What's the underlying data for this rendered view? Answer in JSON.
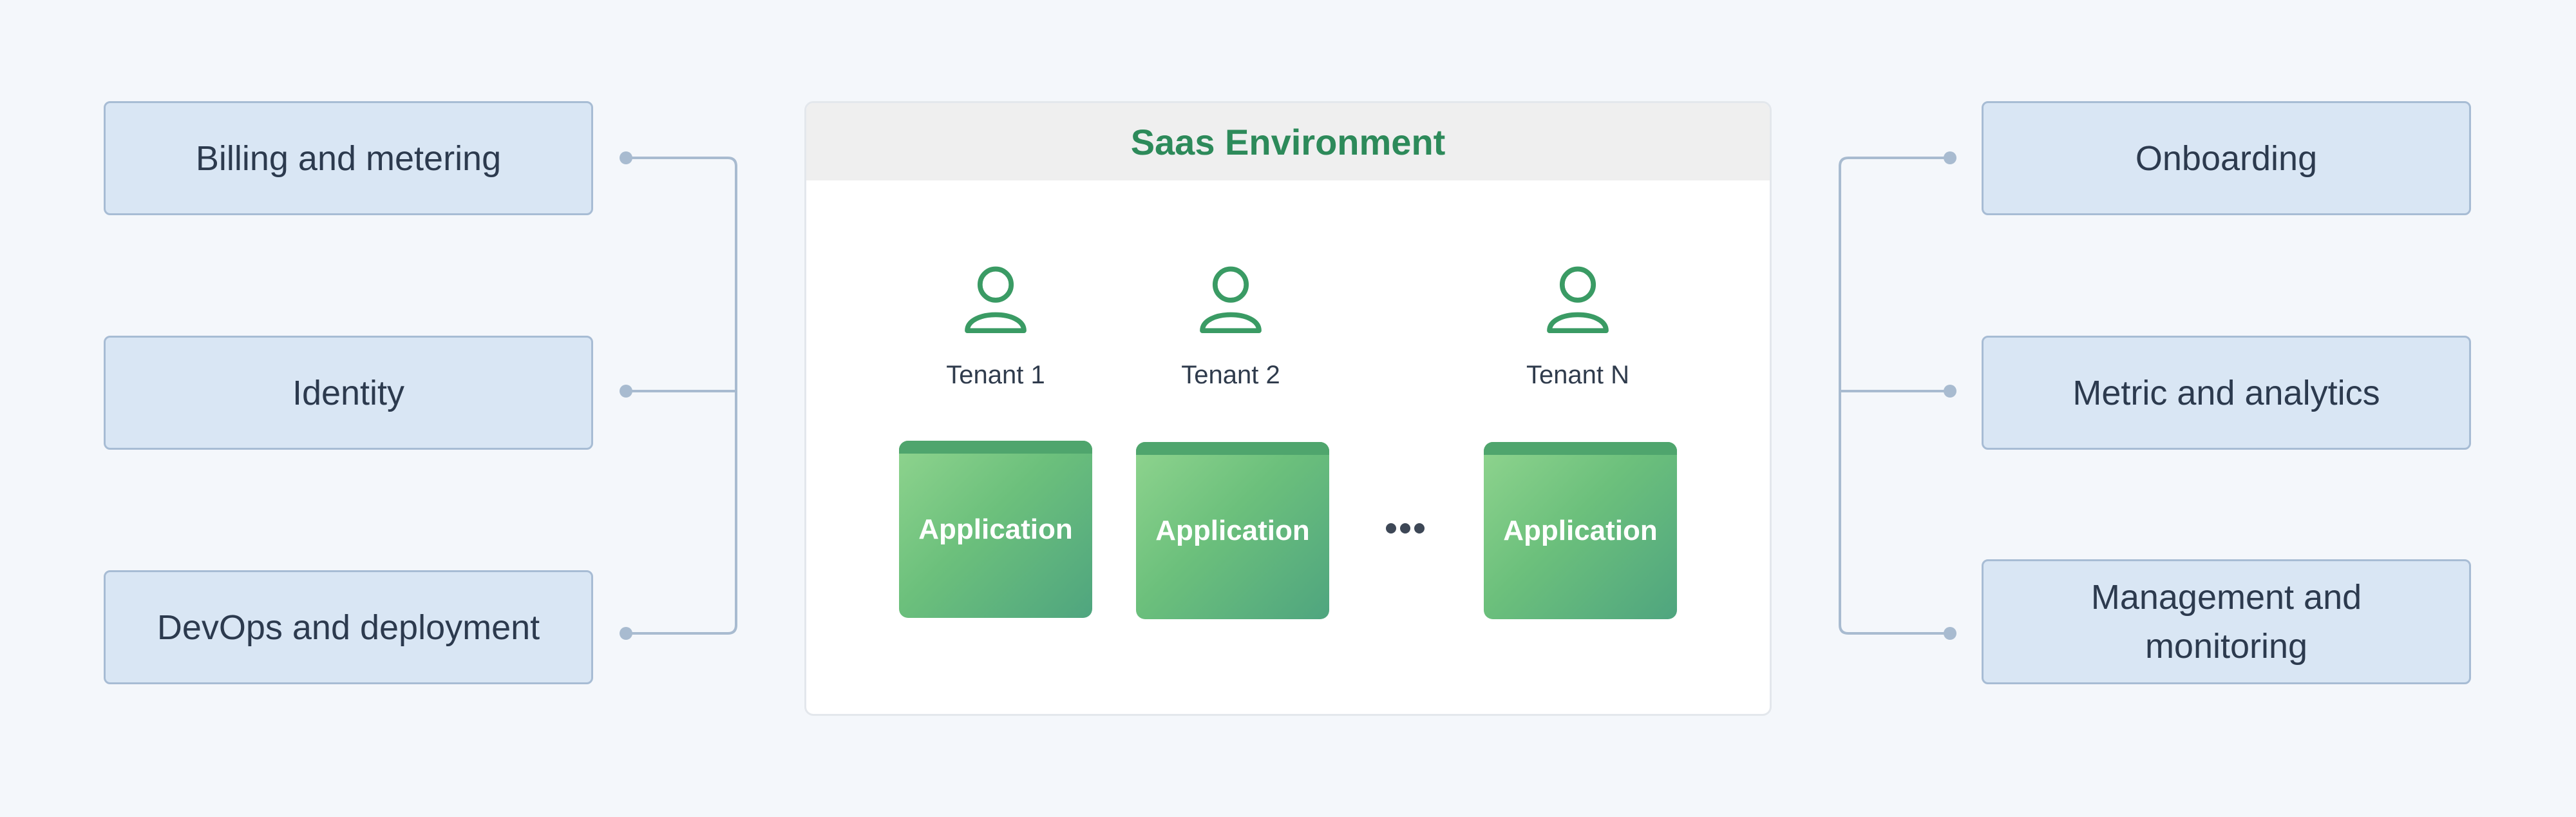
{
  "left_boxes": [
    {
      "label": "Billing and metering"
    },
    {
      "label": "Identity"
    },
    {
      "label": "DevOps and deployment"
    }
  ],
  "right_boxes": [
    {
      "label": "Onboarding"
    },
    {
      "label": "Metric and analytics"
    },
    {
      "label": "Management and monitoring"
    }
  ],
  "saas": {
    "title": "Saas Environment",
    "tenants": [
      {
        "label": "Tenant 1",
        "app_label": "Application"
      },
      {
        "label": "Tenant 2",
        "app_label": "Application"
      },
      {
        "label": "Tenant N",
        "app_label": "Application"
      }
    ],
    "ellipsis_icon": "ellipsis-icon"
  },
  "colors": {
    "background": "#f4f7fb",
    "side_box_fill": "#d9e6f4",
    "side_box_border": "#a7bcd4",
    "connector": "#a8bbd0",
    "accent_green": "#2d8a5a",
    "app_green_light": "#8fd48e",
    "app_green_dark": "#4fa57f"
  }
}
